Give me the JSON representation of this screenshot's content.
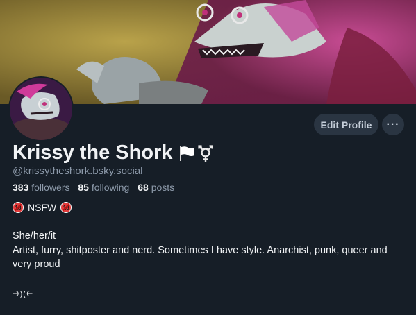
{
  "profile": {
    "display_name": "Krissy the Shork",
    "handle": "@krissytheshork.bsky.social",
    "stats": {
      "followers_count": "383",
      "followers_label": "followers",
      "following_count": "85",
      "following_label": "following",
      "posts_count": "68",
      "posts_label": "posts"
    },
    "labels": {
      "nsfw": "NSFW",
      "nsfw_emoji": "18"
    },
    "bio": {
      "line1": "She/her/it",
      "line2": "Artist, furry, shitposter and nerd. Sometimes I have style. Anarchist, punk, queer and very proud",
      "line3": "∋)(∈"
    }
  },
  "actions": {
    "edit_profile": "Edit Profile",
    "more": "···"
  },
  "icons": {
    "name_icons": [
      "white-flag-icon",
      "transgender-symbol-icon"
    ],
    "nsfw": "no-under-18-icon"
  },
  "colors": {
    "background": "#161e27",
    "button_bg": "#2a3542",
    "muted_text": "#8d9aaa",
    "primary_text": "#f1f3f5"
  }
}
